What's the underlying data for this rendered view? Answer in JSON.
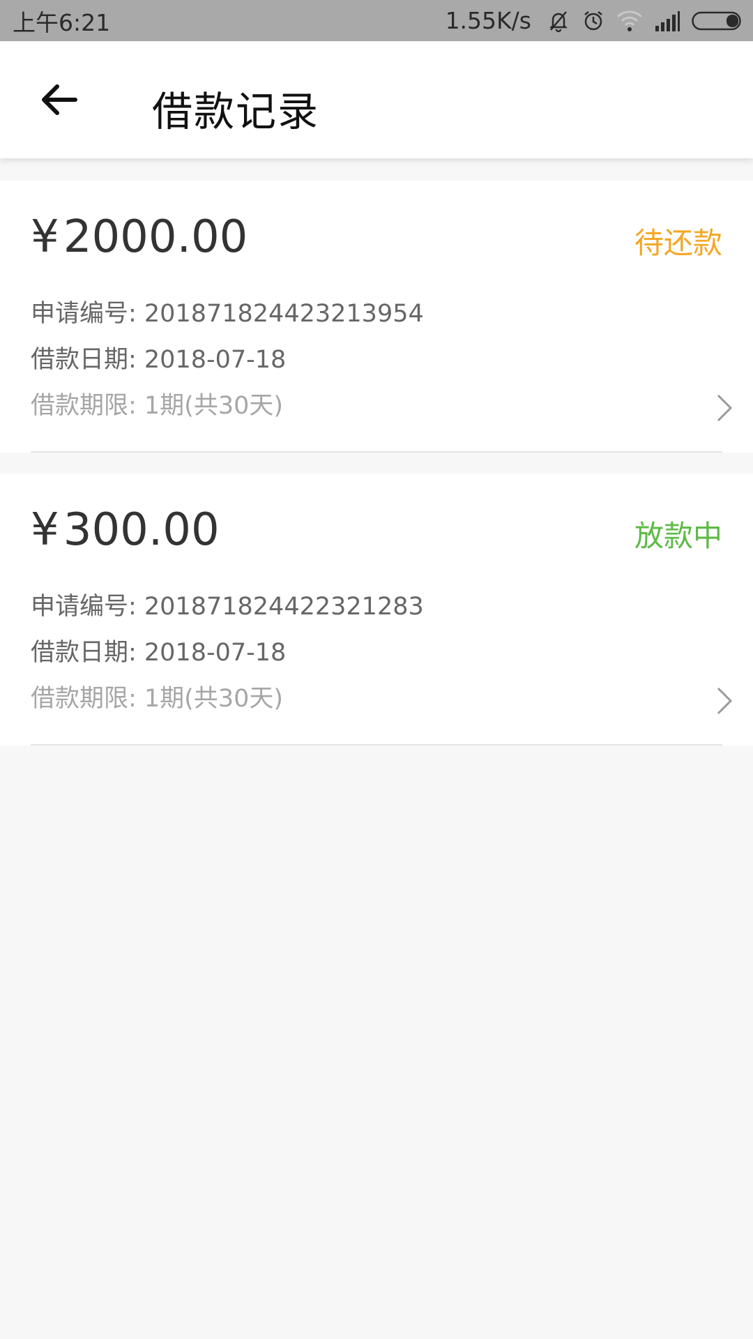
{
  "status_bar": {
    "time": "上午6:21",
    "net_speed": "1.55K/s",
    "icons": [
      "mute-bell-icon",
      "alarm-icon",
      "wifi-icon",
      "signal-icon",
      "battery-icon"
    ]
  },
  "app_bar": {
    "back_icon": "arrow-left-icon",
    "title": "借款记录"
  },
  "loans": [
    {
      "currency": "¥",
      "amount": "2000.00",
      "status": "待还款",
      "status_color": "#f5a623",
      "application_no": "申请编号: 201871824423213954",
      "loan_date": "借款日期: 2018-07-18",
      "term": "借款期限: 1期(共30天)"
    },
    {
      "currency": "¥",
      "amount": "300.00",
      "status": "放款中",
      "status_color": "#5dbb46",
      "application_no": "申请编号: 201871824422321283",
      "loan_date": "借款日期: 2018-07-18",
      "term": "借款期限: 1期(共30天)"
    }
  ]
}
